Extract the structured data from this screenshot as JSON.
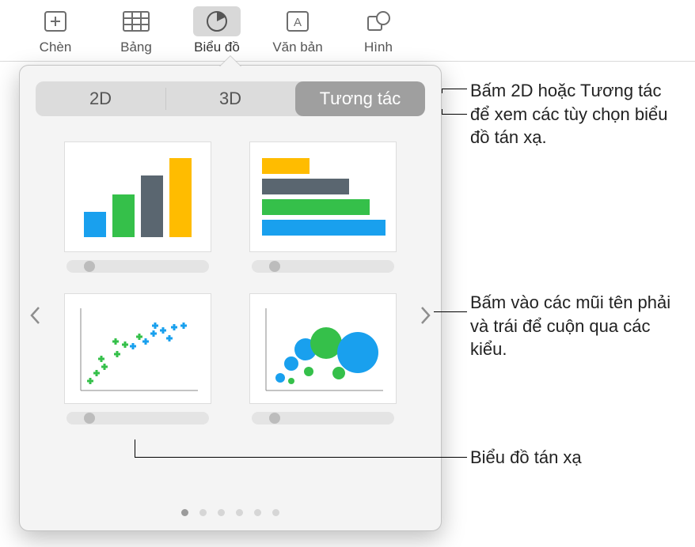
{
  "toolbar": {
    "insert": "Chèn",
    "table": "Bảng",
    "chart": "Biểu đồ",
    "text": "Văn bản",
    "shape": "Hình"
  },
  "segmented": {
    "tab2d": "2D",
    "tab3d": "3D",
    "tabInteractive": "Tương tác"
  },
  "callouts": {
    "top": "Bấm 2D hoặc Tương tác để xem các tùy chọn biểu đồ tán xạ.",
    "mid": "Bấm vào các mũi tên phải và trái để cuộn qua các kiểu.",
    "bottom": "Biểu đồ tán xạ"
  },
  "chart_options": {
    "opt1": "interactive-column-chart",
    "opt2": "interactive-bar-chart",
    "opt3": "interactive-scatter-chart",
    "opt4": "interactive-bubble-chart"
  },
  "pager": {
    "count": 6,
    "active": 0
  }
}
